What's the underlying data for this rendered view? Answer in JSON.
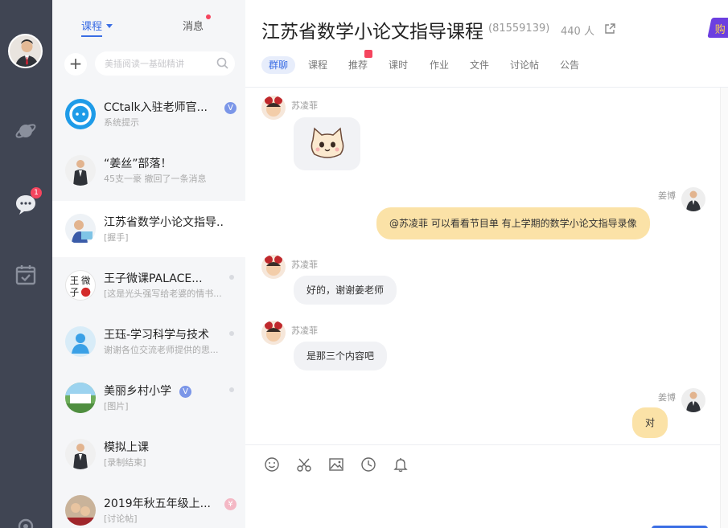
{
  "tabs": {
    "courses": "课程",
    "messages": "消息"
  },
  "search": {
    "placeholder": "美插阅读一基础精讲"
  },
  "rail": {
    "chat_badge": "1"
  },
  "conversations": [
    {
      "name": "CCtalk入驻老师官...",
      "sub": "系统提示",
      "mark": "V"
    },
    {
      "name": "“姜丝”部落！",
      "sub": "45支一豪 撤回了一条消息"
    },
    {
      "name": "江苏省数学小论文指导...",
      "sub": "[握手]"
    },
    {
      "name": "王子微课PALACE...",
      "sub": "[这是光头强写给老婆的情书..."
    },
    {
      "name": "王珏-学习科学与技术",
      "sub": "谢谢各位交流老师提供的思..."
    },
    {
      "name": "美丽乡村小学",
      "sub": "[图片]",
      "mark": "V"
    },
    {
      "name": "模拟上课",
      "sub": "[录制结束]"
    },
    {
      "name": "2019年秋五年级上...",
      "sub": "[讨论帖]",
      "mark": "¥"
    }
  ],
  "group": {
    "title": "江苏省数学小论文指导课程",
    "id": "(81559139)",
    "members": "440 人",
    "corner_label": "购"
  },
  "subtabs": [
    "群聊",
    "课程",
    "推荐",
    "课时",
    "作业",
    "文件",
    "讨论帖",
    "公告"
  ],
  "messages": [
    {
      "sender": "苏凌菲",
      "type": "sticker"
    },
    {
      "sender": "姜博",
      "text": "@苏凌菲  可以看看节目单 有上学期的数学小论文指导录像"
    },
    {
      "sender": "苏凌菲",
      "text": "好的，谢谢姜老师"
    },
    {
      "sender": "苏凌菲",
      "text": "是那三个内容吧"
    },
    {
      "sender": "姜博",
      "text": "对"
    }
  ],
  "toolbar": [
    "emoji-icon",
    "scissors-icon",
    "image-icon",
    "clock-icon",
    "bell-icon"
  ],
  "colors": {
    "accent": "#3a6de4",
    "rail": "#404553",
    "out_bubble": "#fbe2a7",
    "badge": "#f5455e"
  }
}
